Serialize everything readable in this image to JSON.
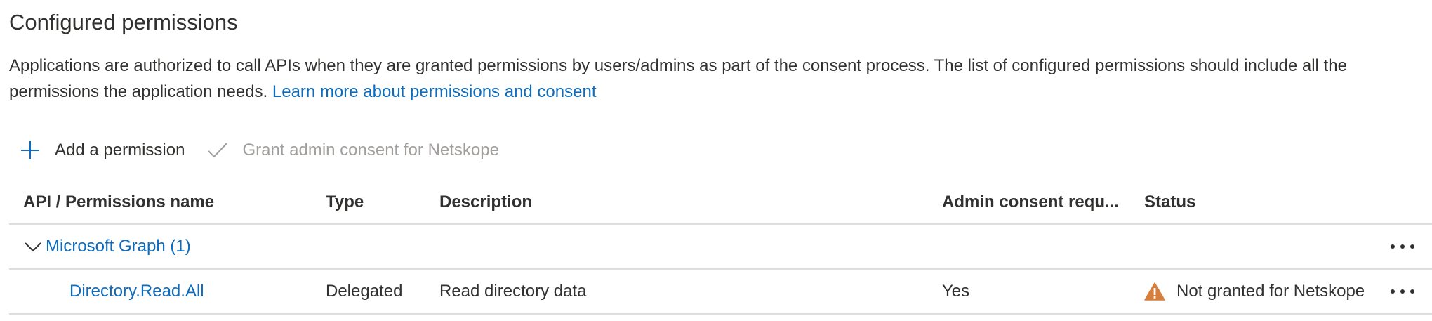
{
  "header": {
    "title": "Configured permissions",
    "description": "Applications are authorized to call APIs when they are granted permissions by users/admins as part of the consent process. The list of configured permissions should include all the permissions the application needs. ",
    "learn_more_link": "Learn more about permissions and consent"
  },
  "toolbar": {
    "add_label": "Add a permission",
    "grant_label": "Grant admin consent for Netskope",
    "add_icon": "plus-icon",
    "grant_icon": "checkmark-icon"
  },
  "table": {
    "columns": {
      "api": "API / Permissions name",
      "type": "Type",
      "description": "Description",
      "admin": "Admin consent requ...",
      "status": "Status"
    },
    "groups": [
      {
        "name": "Microsoft Graph (1)",
        "expanded": true,
        "permissions": [
          {
            "name": "Directory.Read.All",
            "type": "Delegated",
            "description": "Read directory data",
            "admin_consent_required": "Yes",
            "status": "Not granted for Netskope",
            "status_icon": "warning-icon"
          }
        ]
      }
    ]
  },
  "colors": {
    "link": "#0f6cbd",
    "text": "#323130",
    "disabled": "#a19f9d",
    "warning": "#d67f3c",
    "divider": "#e1dfdd"
  }
}
